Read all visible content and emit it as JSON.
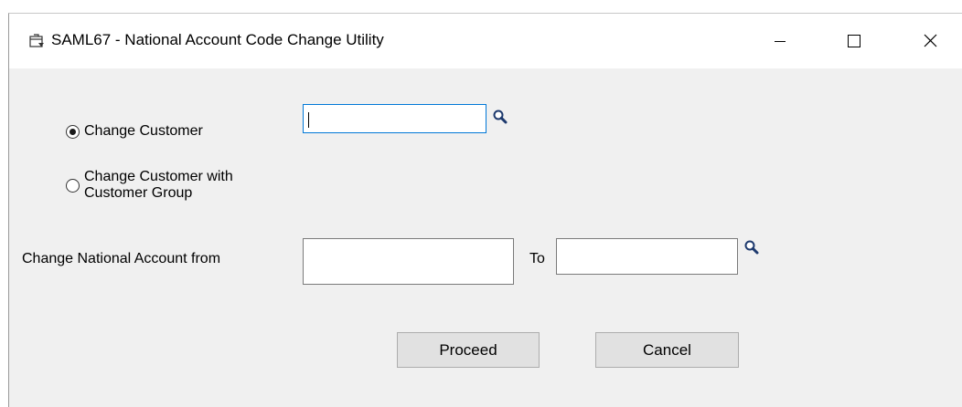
{
  "window": {
    "title": "SAML67 - National Account Code Change Utility",
    "icons": {
      "app": "form-window-icon",
      "minimize": "minimize-icon",
      "maximize": "maximize-icon",
      "close": "close-icon"
    }
  },
  "options": {
    "change_customer": {
      "label": "Change Customer",
      "selected": true
    },
    "change_customer_group": {
      "label_line1": "Change Customer with",
      "label_line2": "Customer Group",
      "selected": false
    }
  },
  "customer_field": {
    "value": "",
    "lookup_icon": "search-icon"
  },
  "national_account": {
    "from_label": "Change National Account from",
    "from_value": "",
    "to_label": "To",
    "to_value": "",
    "lookup_icon": "search-icon"
  },
  "buttons": {
    "proceed": "Proceed",
    "cancel": "Cancel"
  }
}
